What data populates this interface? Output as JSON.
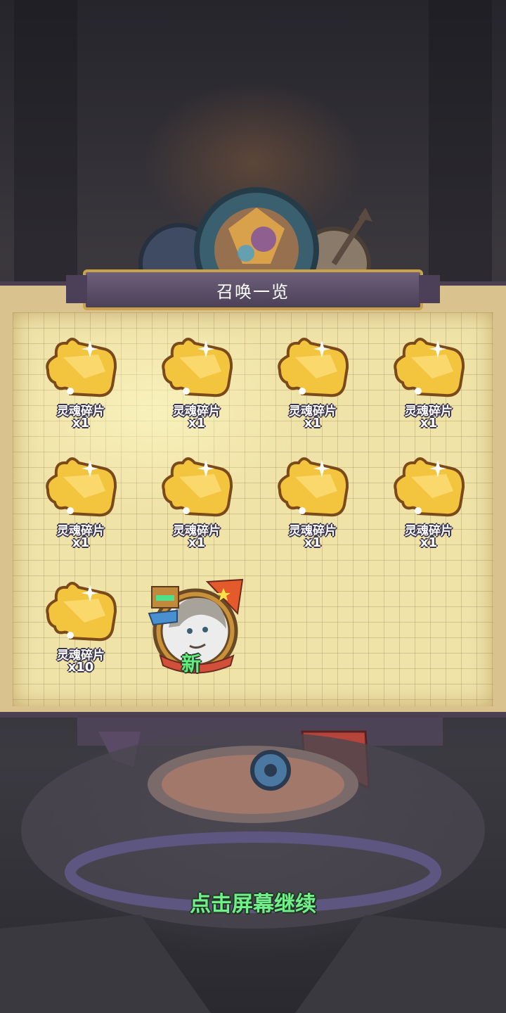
{
  "title": "召唤一览",
  "items": [
    {
      "label": "灵魂碎片",
      "qty": "x1"
    },
    {
      "label": "灵魂碎片",
      "qty": "x1"
    },
    {
      "label": "灵魂碎片",
      "qty": "x1"
    },
    {
      "label": "灵魂碎片",
      "qty": "x1"
    },
    {
      "label": "灵魂碎片",
      "qty": "x1"
    },
    {
      "label": "灵魂碎片",
      "qty": "x1"
    },
    {
      "label": "灵魂碎片",
      "qty": "x1"
    },
    {
      "label": "灵魂碎片",
      "qty": "x1"
    },
    {
      "label": "灵魂碎片",
      "qty": "x10"
    }
  ],
  "hero": {
    "badge": "新",
    "icon": "hero-portrait-icon"
  },
  "continue_hint": "点击屏幕继续",
  "colors": {
    "panel_frame": "#4b3f52",
    "banner_gold": "#c9a24a",
    "hint_green": "#6ff08a",
    "piece_gold": "#f3c53f"
  }
}
